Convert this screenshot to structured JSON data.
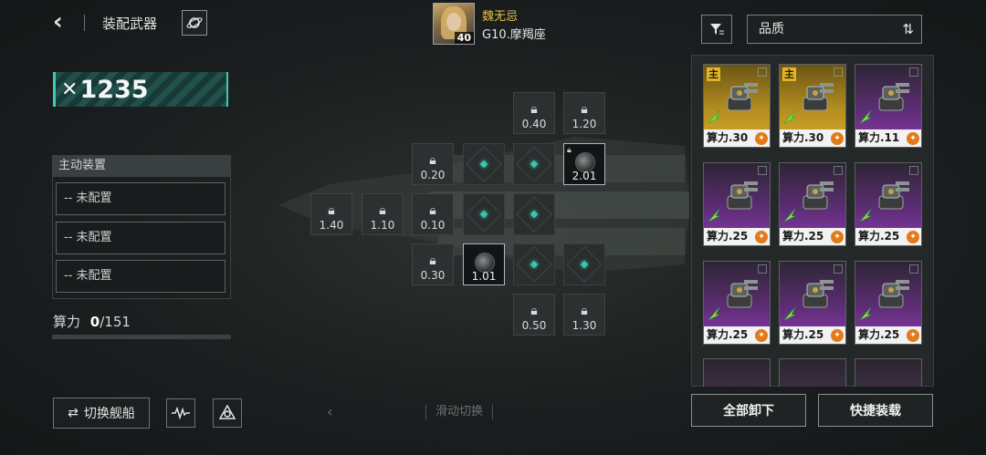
{
  "header": {
    "back_icon": "chevron-left-icon",
    "title": "装配武器",
    "planet_icon": "planet-icon"
  },
  "power": {
    "value": "1235",
    "icon": "crossed-swords-icon"
  },
  "active_devices": {
    "title": "主动装置",
    "slots": [
      "-- 未配置",
      "-- 未配置",
      "-- 未配置"
    ]
  },
  "compute": {
    "label": "算力",
    "used": "0",
    "total": "/151"
  },
  "bottom_left": {
    "switch_label": "切换舰船",
    "icon_1": "waveform-icon",
    "icon_2": "target-icon"
  },
  "swipe_hint": "滑动切换",
  "captain": {
    "name": "魏无忌",
    "level": "40",
    "ship": "G10.摩羯座"
  },
  "grid": {
    "locked": [
      {
        "id": "l1",
        "value": "0.40"
      },
      {
        "id": "l2",
        "value": "1.20"
      },
      {
        "id": "l3",
        "value": "0.20"
      },
      {
        "id": "l4",
        "value": "1.40"
      },
      {
        "id": "l5",
        "value": "1.10"
      },
      {
        "id": "l6",
        "value": "0.10"
      },
      {
        "id": "l7",
        "value": "0.30"
      },
      {
        "id": "l8",
        "value": "0.50"
      },
      {
        "id": "l9",
        "value": "1.30"
      }
    ],
    "filled": [
      {
        "id": "f1",
        "value": "2.01"
      },
      {
        "id": "f2",
        "value": "1.01"
      }
    ]
  },
  "right_panel": {
    "filter_icon": "filter-icon",
    "sort_label": "品质",
    "sort_icon": "sort-icon",
    "cards": [
      {
        "tier": "gold",
        "tag": "主",
        "label": "算力.30",
        "type_icon": "lightning-icon"
      },
      {
        "tier": "gold",
        "tag": "主",
        "label": "算力.30",
        "type_icon": "shield-icon"
      },
      {
        "tier": "purple",
        "tag": "",
        "label": "算力.11",
        "type_icon": "laser-icon"
      },
      {
        "tier": "purple",
        "tag": "",
        "label": "算力.25",
        "type_icon": "laser-icon"
      },
      {
        "tier": "purple",
        "tag": "",
        "label": "算力.25",
        "type_icon": "laser-icon"
      },
      {
        "tier": "purple",
        "tag": "",
        "label": "算力.25",
        "type_icon": "laser-icon"
      },
      {
        "tier": "purple",
        "tag": "",
        "label": "算力.25",
        "type_icon": "laser-icon"
      },
      {
        "tier": "purple",
        "tag": "",
        "label": "算力.25",
        "type_icon": "laser-icon"
      },
      {
        "tier": "purple",
        "tag": "",
        "label": "算力.25",
        "type_icon": "laser-icon"
      }
    ],
    "unload_all": "全部卸下",
    "quick_equip": "快捷装载"
  },
  "colors": {
    "accent": "#3fc9b5",
    "gold": "#d7ab2a",
    "purple": "#8a3ab0"
  }
}
